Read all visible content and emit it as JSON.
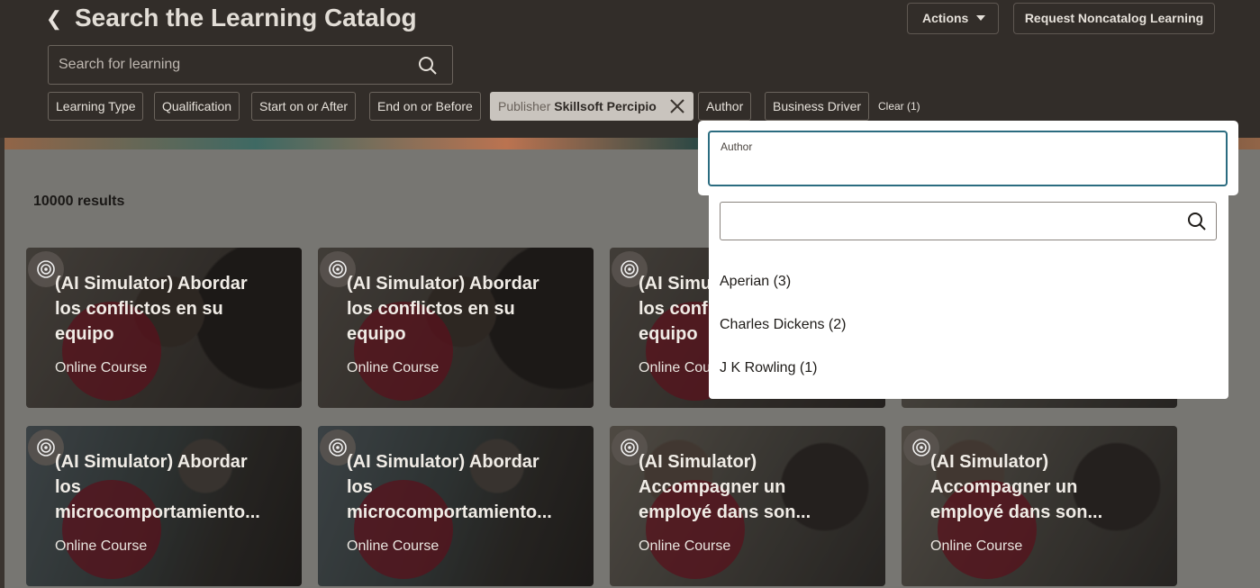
{
  "header": {
    "title": "Search the Learning Catalog",
    "actions_label": "Actions",
    "noncatalog_label": "Request Noncatalog Learning",
    "search_placeholder": "Search for learning"
  },
  "filters": {
    "chips": [
      "Learning Type",
      "Qualification",
      "Start on or After",
      "End on or Before",
      "Author",
      "Business Driver"
    ],
    "active_chip": {
      "key": "Publisher",
      "value": "Skillsoft Percipio"
    },
    "clear_label": "Clear (1)"
  },
  "results": {
    "count_label": "10000 results"
  },
  "cards": [
    {
      "title": "(AI Simulator) Abordar los conflictos en su equipo",
      "type": "Online Course"
    },
    {
      "title": "(AI Simulator) Abordar los conflictos en su equipo",
      "type": "Online Course"
    },
    {
      "title": "(AI Simulator) Abordar los conflictos en su equipo",
      "type": "Online Course"
    },
    {
      "title": "(AI Simulator) Abordar los microcomportamiento...",
      "type": "Online Course"
    },
    {
      "title": "(AI Simulator) Abordar los microcomportamiento...",
      "type": "Online Course"
    },
    {
      "title": "(AI Simulator) Accompagner un employé dans son...",
      "type": "Online Course"
    },
    {
      "title": "(AI Simulator) Accompagner un employé dans son...",
      "type": "Online Course"
    }
  ],
  "author_dropdown": {
    "field_label": "Author",
    "field_value": "",
    "search_value": "",
    "options": [
      "Aperian (3)",
      "Charles Dickens (2)",
      "J K Rowling (1)"
    ]
  },
  "colors": {
    "accent_focus": "#2b6c80",
    "header_bg": "#322d29",
    "blob": "#8e1e2d"
  }
}
